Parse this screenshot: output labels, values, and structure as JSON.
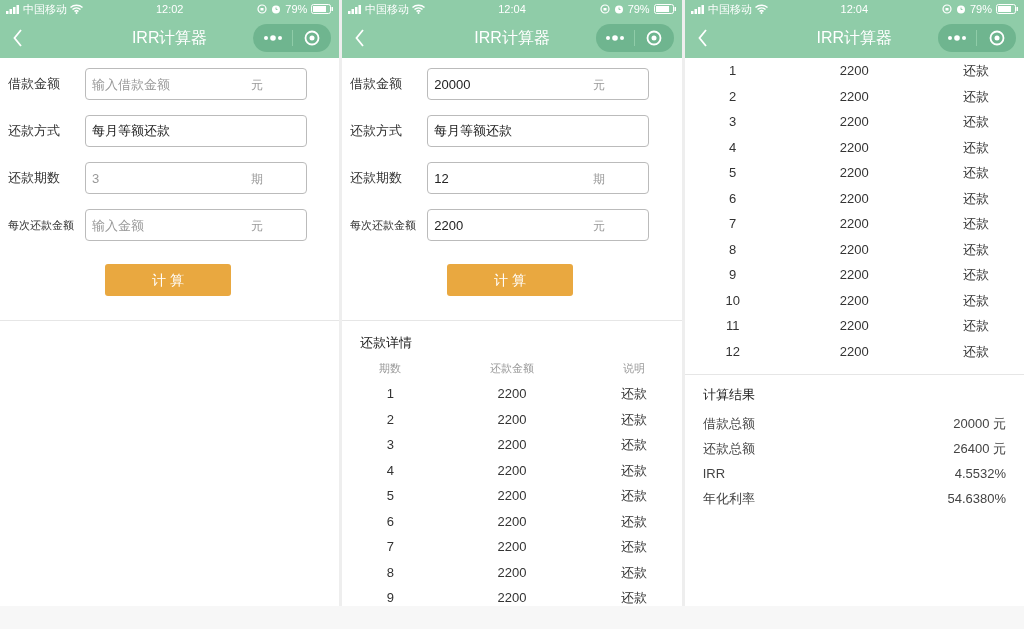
{
  "screens": [
    {
      "status_bar": {
        "carrier": "中国移动",
        "time": "12:02",
        "battery": "79%"
      },
      "nav": {
        "title": "IRR计算器"
      },
      "form": {
        "fields": [
          {
            "label": "借款金额",
            "placeholder": "输入借款金额",
            "unit": "元"
          },
          {
            "label": "还款方式",
            "value": "每月等额还款"
          },
          {
            "label": "还款期数",
            "placeholder": "3",
            "unit": "期"
          },
          {
            "label": "每次还款金额",
            "placeholder": "输入金额",
            "unit": "元"
          }
        ],
        "button": "计 算"
      }
    },
    {
      "status_bar": {
        "carrier": "中国移动",
        "time": "12:04",
        "battery": "79%"
      },
      "nav": {
        "title": "IRR计算器"
      },
      "form": {
        "fields": [
          {
            "label": "借款金额",
            "value": "20000",
            "unit": "元"
          },
          {
            "label": "还款方式",
            "value": "每月等额还款"
          },
          {
            "label": "还款期数",
            "value": "12",
            "unit": "期"
          },
          {
            "label": "每次还款金额",
            "value": "2200",
            "unit": "元"
          }
        ],
        "button": "计 算"
      },
      "details": {
        "title": "还款详情",
        "columns": [
          "期数",
          "还款金额",
          "说明"
        ],
        "rows": [
          [
            "1",
            "2200",
            "还款"
          ],
          [
            "2",
            "2200",
            "还款"
          ],
          [
            "3",
            "2200",
            "还款"
          ],
          [
            "4",
            "2200",
            "还款"
          ],
          [
            "5",
            "2200",
            "还款"
          ],
          [
            "6",
            "2200",
            "还款"
          ],
          [
            "7",
            "2200",
            "还款"
          ],
          [
            "8",
            "2200",
            "还款"
          ],
          [
            "9",
            "2200",
            "还款"
          ]
        ]
      }
    },
    {
      "status_bar": {
        "carrier": "中国移动",
        "time": "12:04",
        "battery": "79%"
      },
      "nav": {
        "title": "IRR计算器"
      },
      "details": {
        "rows": [
          [
            "1",
            "2200",
            "还款"
          ],
          [
            "2",
            "2200",
            "还款"
          ],
          [
            "3",
            "2200",
            "还款"
          ],
          [
            "4",
            "2200",
            "还款"
          ],
          [
            "5",
            "2200",
            "还款"
          ],
          [
            "6",
            "2200",
            "还款"
          ],
          [
            "7",
            "2200",
            "还款"
          ],
          [
            "8",
            "2200",
            "还款"
          ],
          [
            "9",
            "2200",
            "还款"
          ],
          [
            "10",
            "2200",
            "还款"
          ],
          [
            "11",
            "2200",
            "还款"
          ],
          [
            "12",
            "2200",
            "还款"
          ]
        ]
      },
      "results": {
        "title": "计算结果",
        "items": [
          {
            "label": "借款总额",
            "value": "20000 元"
          },
          {
            "label": "还款总额",
            "value": "26400 元"
          },
          {
            "label": "IRR",
            "value": "4.5532%"
          },
          {
            "label": "年化利率",
            "value": "54.6380%"
          }
        ]
      }
    }
  ]
}
